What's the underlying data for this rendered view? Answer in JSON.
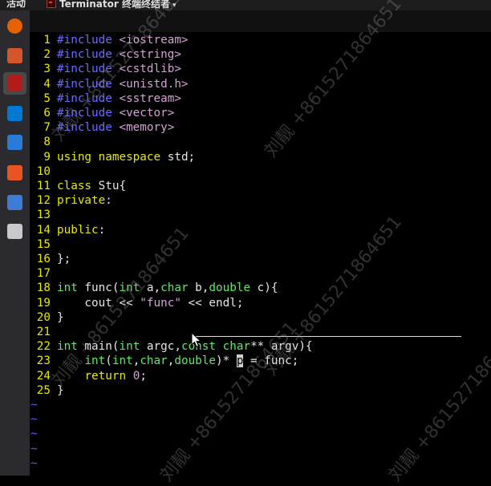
{
  "topbar": {
    "activities": "活动",
    "app_title": "Terminator 终端终结者"
  },
  "dock": [
    {
      "name": "firefox",
      "color": "#e66000"
    },
    {
      "name": "files",
      "color": "#d6562b"
    },
    {
      "name": "terminator",
      "color": "#b31b1b"
    },
    {
      "name": "vscode",
      "color": "#0078d4"
    },
    {
      "name": "visual-paradigm",
      "color": "#2a7bd8"
    },
    {
      "name": "software-center",
      "color": "#e95420"
    },
    {
      "name": "network",
      "color": "#3c7bd6"
    },
    {
      "name": "text-editor",
      "color": "#c9c9c9"
    }
  ],
  "watermark": "刘靓 +8615271864651",
  "editor": {
    "lines": [
      {
        "n": "1",
        "segs": [
          [
            "pp",
            "#include "
          ],
          [
            "str",
            "<iostream>"
          ]
        ]
      },
      {
        "n": "2",
        "segs": [
          [
            "pp",
            "#include "
          ],
          [
            "str",
            "<cstring>"
          ]
        ]
      },
      {
        "n": "3",
        "segs": [
          [
            "pp",
            "#include "
          ],
          [
            "str",
            "<cstdlib>"
          ]
        ]
      },
      {
        "n": "4",
        "segs": [
          [
            "pp",
            "#include "
          ],
          [
            "str",
            "<unistd.h>"
          ]
        ]
      },
      {
        "n": "5",
        "segs": [
          [
            "pp",
            "#include "
          ],
          [
            "str",
            "<sstream>"
          ]
        ]
      },
      {
        "n": "6",
        "segs": [
          [
            "pp",
            "#include "
          ],
          [
            "str",
            "<vector>"
          ]
        ]
      },
      {
        "n": "7",
        "segs": [
          [
            "pp",
            "#include "
          ],
          [
            "str",
            "<memory>"
          ]
        ]
      },
      {
        "n": "8",
        "segs": []
      },
      {
        "n": "9",
        "segs": [
          [
            "kw",
            "using namespace"
          ],
          [
            "tx",
            " std;"
          ]
        ]
      },
      {
        "n": "10",
        "segs": []
      },
      {
        "n": "11",
        "segs": [
          [
            "kw",
            "class"
          ],
          [
            "tx",
            " Stu{"
          ]
        ]
      },
      {
        "n": "12",
        "segs": [
          [
            "kw",
            "private"
          ],
          [
            "tx",
            ":"
          ]
        ]
      },
      {
        "n": "13",
        "segs": []
      },
      {
        "n": "14",
        "segs": [
          [
            "kw",
            "public"
          ],
          [
            "tx",
            ":"
          ]
        ]
      },
      {
        "n": "15",
        "segs": []
      },
      {
        "n": "16",
        "segs": [
          [
            "tx",
            "};"
          ]
        ]
      },
      {
        "n": "17",
        "segs": []
      },
      {
        "n": "18",
        "segs": [
          [
            "ty",
            "int"
          ],
          [
            "tx",
            " func("
          ],
          [
            "ty",
            "int"
          ],
          [
            "tx",
            " a,"
          ],
          [
            "ty",
            "char"
          ],
          [
            "tx",
            " b,"
          ],
          [
            "ty",
            "double"
          ],
          [
            "tx",
            " c){"
          ]
        ]
      },
      {
        "n": "19",
        "segs": [
          [
            "tx",
            "    cout << "
          ],
          [
            "str",
            "\"func\""
          ],
          [
            "tx",
            " << endl;"
          ]
        ]
      },
      {
        "n": "20",
        "segs": [
          [
            "tx",
            "}"
          ]
        ]
      },
      {
        "n": "21",
        "segs": []
      },
      {
        "n": "22",
        "segs": [
          [
            "ty",
            "int"
          ],
          [
            "tx",
            " main("
          ],
          [
            "ty",
            "int"
          ],
          [
            "tx",
            " argc,"
          ],
          [
            "ty",
            "const"
          ],
          [
            "tx",
            " "
          ],
          [
            "ty",
            "char"
          ],
          [
            "tx",
            "** argv){"
          ]
        ]
      },
      {
        "n": "23",
        "segs": [
          [
            "tx",
            "    "
          ],
          [
            "ty",
            "int"
          ],
          [
            "tx",
            "("
          ],
          [
            "ty",
            "int"
          ],
          [
            "tx",
            ","
          ],
          [
            "ty",
            "char"
          ],
          [
            "tx",
            ","
          ],
          [
            "ty",
            "double"
          ],
          [
            "tx",
            ")* "
          ],
          [
            "cur",
            "p"
          ],
          [
            "tx",
            " = func;"
          ]
        ]
      },
      {
        "n": "24",
        "segs": [
          [
            "tx",
            "    "
          ],
          [
            "kw",
            "return"
          ],
          [
            "tx",
            " "
          ],
          [
            "str",
            "0"
          ],
          [
            "tx",
            ";"
          ]
        ]
      },
      {
        "n": "25",
        "segs": [
          [
            "tx",
            "}"
          ]
        ]
      }
    ],
    "tildes": [
      "~",
      "~",
      "~",
      "~",
      "~"
    ]
  }
}
